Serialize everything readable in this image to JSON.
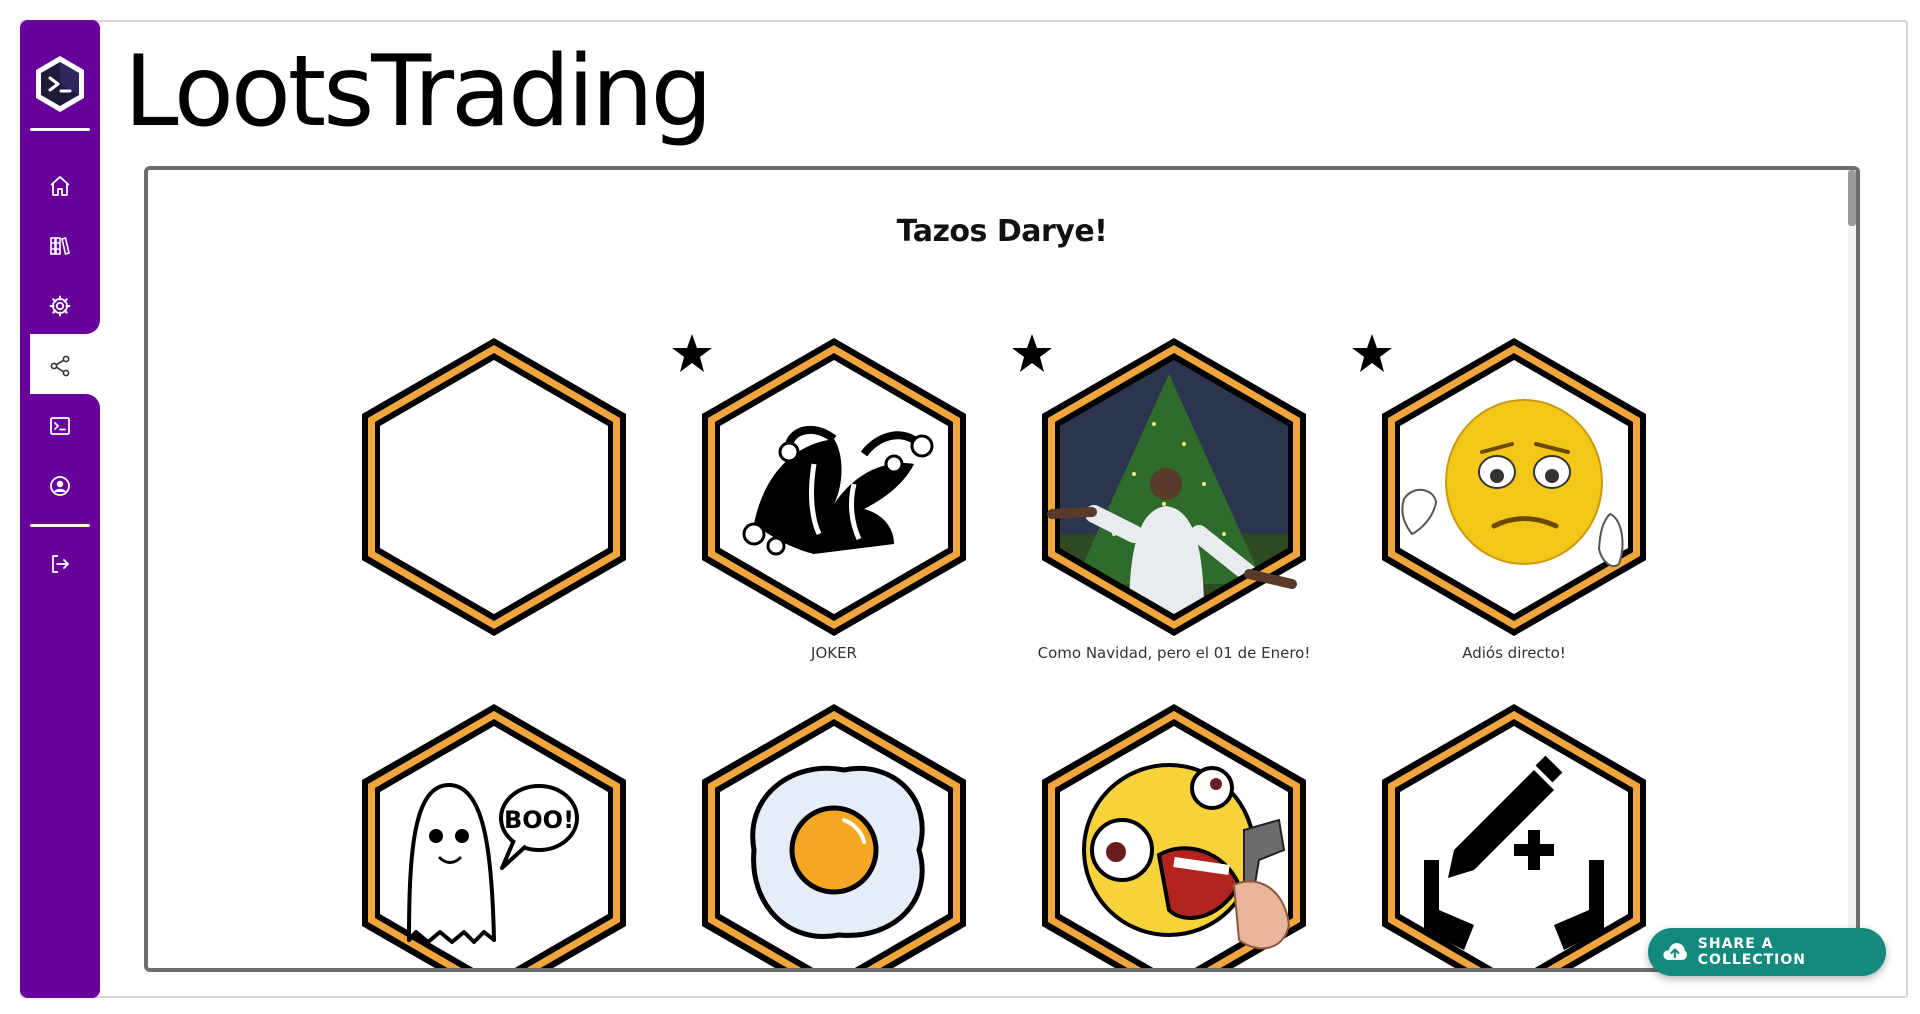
{
  "app": {
    "title": "LootsTrading"
  },
  "sidebar": {
    "items": [
      {
        "name": "home-icon"
      },
      {
        "name": "library-icon"
      },
      {
        "name": "settings-icon"
      },
      {
        "name": "share-icon",
        "active": true
      },
      {
        "name": "terminal-icon"
      },
      {
        "name": "account-icon"
      },
      {
        "name": "logout-icon"
      }
    ]
  },
  "collection": {
    "title": "Tazos Darye!",
    "tazos": [
      {
        "caption": "",
        "starred": false,
        "image": "empty"
      },
      {
        "caption": "JOKER",
        "starred": true,
        "image": "jester-hat"
      },
      {
        "caption": "Como Navidad, pero el 01 de Enero!",
        "starred": true,
        "image": "christmas-tree-man"
      },
      {
        "caption": "Adiós directo!",
        "starred": true,
        "image": "sad-emoji-thumbs-down"
      },
      {
        "caption": "",
        "starred": false,
        "image": "ghost-boo"
      },
      {
        "caption": "",
        "starred": false,
        "image": "fried-egg"
      },
      {
        "caption": "",
        "starred": false,
        "image": "shocked-emoji-gun"
      },
      {
        "caption": "",
        "starred": false,
        "image": "pencil-hands-plus"
      }
    ]
  },
  "share_button": {
    "label": "SHARE A COLLECTION",
    "icon": "cloud-upload-icon"
  },
  "colors": {
    "brand": "#67039a",
    "hex_border": "#f0a63c",
    "accent": "#138a7d"
  }
}
